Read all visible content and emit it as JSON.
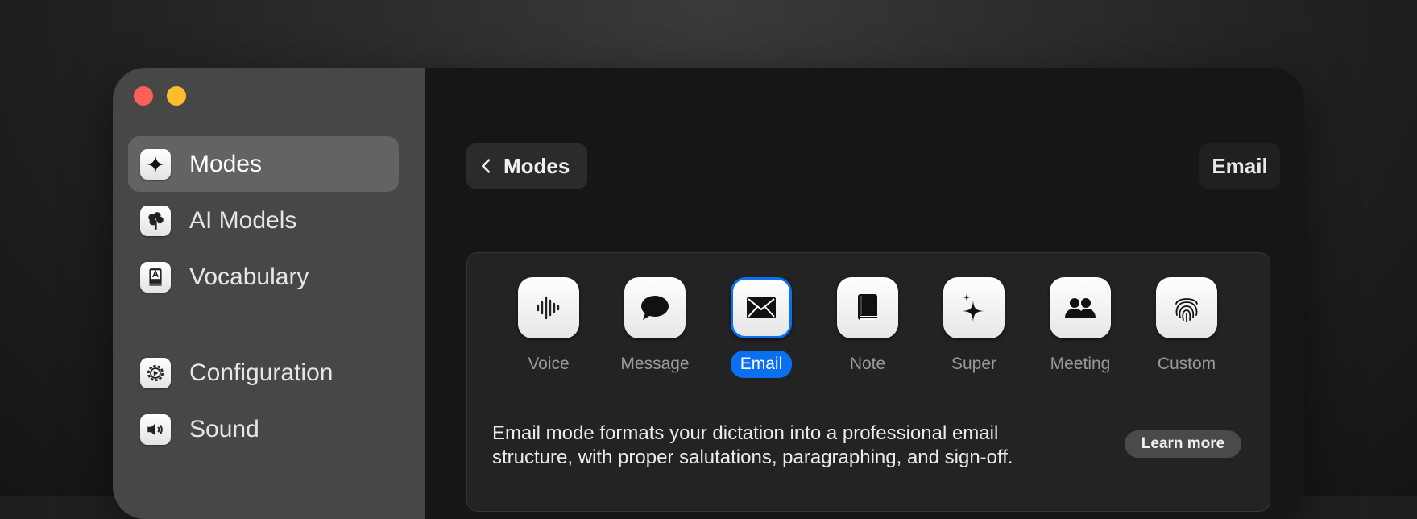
{
  "sidebar": {
    "items": [
      {
        "label": "Modes",
        "icon": "sparkle-icon",
        "selected": true
      },
      {
        "label": "AI Models",
        "icon": "brain-tree-icon",
        "selected": false
      },
      {
        "label": "Vocabulary",
        "icon": "dictionary-icon",
        "selected": false
      },
      {
        "label": "Configuration",
        "icon": "gear-icon",
        "selected": false
      },
      {
        "label": "Sound",
        "icon": "speaker-icon",
        "selected": false
      }
    ]
  },
  "header": {
    "back_label": "Modes",
    "title": "Email"
  },
  "modes": {
    "items": [
      {
        "label": "Voice",
        "icon": "waveform-icon"
      },
      {
        "label": "Message",
        "icon": "speech-bubble-icon"
      },
      {
        "label": "Email",
        "icon": "envelope-icon",
        "selected": true
      },
      {
        "label": "Note",
        "icon": "book-icon"
      },
      {
        "label": "Super",
        "icon": "sparkles-icon"
      },
      {
        "label": "Meeting",
        "icon": "people-icon"
      },
      {
        "label": "Custom",
        "icon": "fingerprint-icon"
      }
    ],
    "description_line1": "Email mode formats your dictation into a professional email",
    "description_line2": "structure, with proper salutations, paragraphing, and sign-off.",
    "learn_more_label": "Learn more"
  },
  "colors": {
    "accent": "#0a6ff0",
    "close": "#fe5f57",
    "minimize": "#febc2e"
  }
}
